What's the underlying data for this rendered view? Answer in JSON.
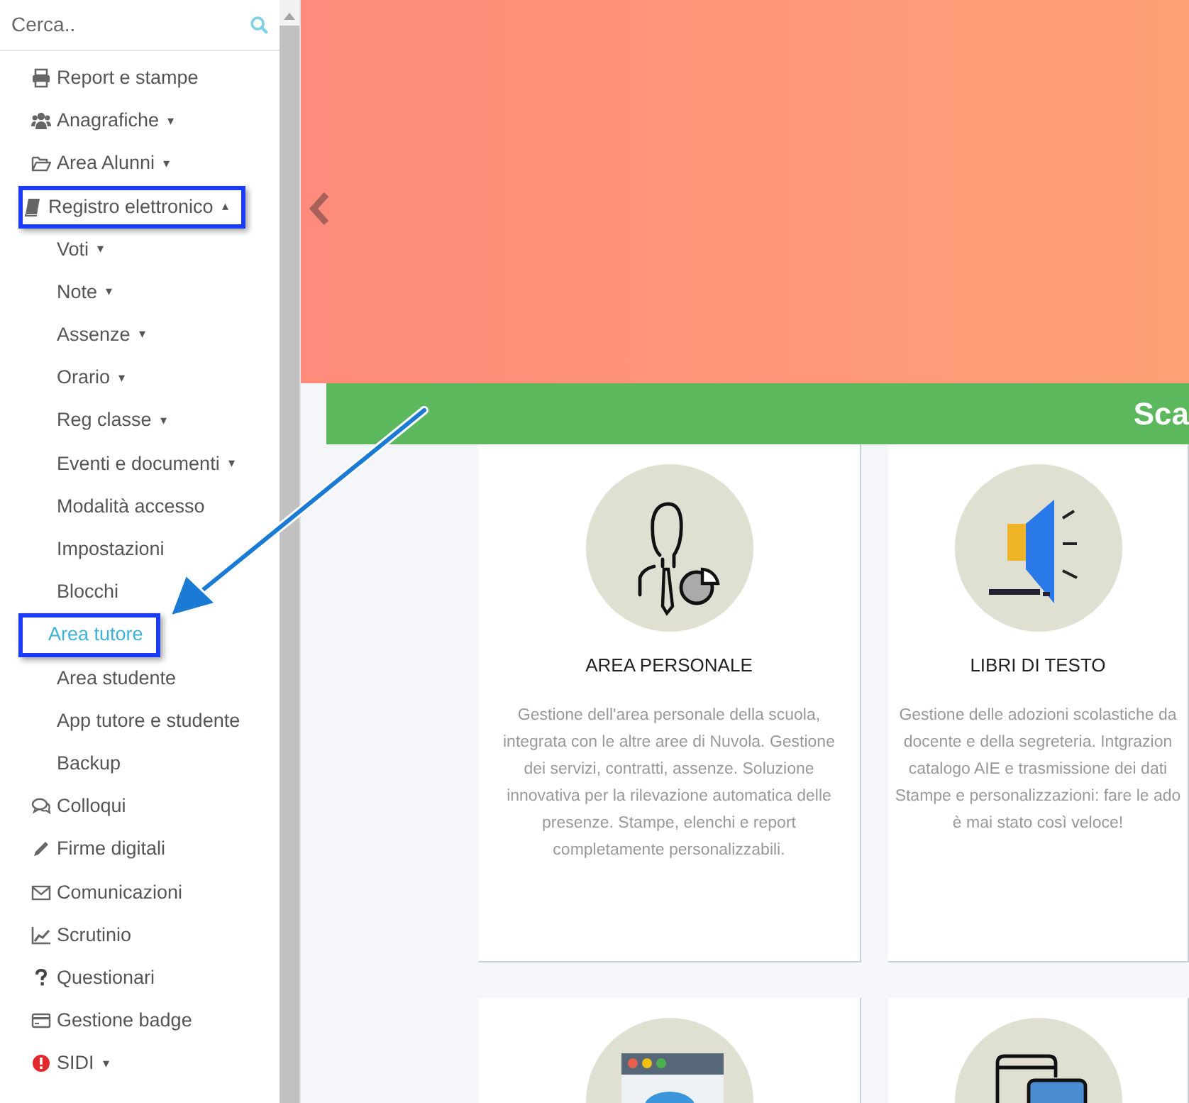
{
  "search": {
    "placeholder": "Cerca.."
  },
  "sidebar": {
    "items": [
      {
        "label": "Report e stampe",
        "selected": false,
        "annotated": false
      },
      {
        "label": "Anagrafiche",
        "caret": "▾",
        "selected": false,
        "annotated": false
      },
      {
        "label": "Area Alunni",
        "caret": "▾",
        "selected": false,
        "annotated": false
      },
      {
        "label": "Registro elettronico",
        "caret": "▴",
        "selected": false,
        "annotated": true,
        "children": [
          {
            "label": "Voti",
            "caret": "▾",
            "selected": false,
            "annotated": false
          },
          {
            "label": "Note",
            "caret": "▾",
            "selected": false,
            "annotated": false
          },
          {
            "label": "Assenze",
            "caret": "▾",
            "selected": false,
            "annotated": false
          },
          {
            "label": "Orario",
            "caret": "▾",
            "selected": false,
            "annotated": false
          },
          {
            "label": "Reg classe",
            "caret": "▾",
            "selected": false,
            "annotated": false
          },
          {
            "label": "Eventi e documenti",
            "caret": "▾",
            "selected": false,
            "annotated": false
          },
          {
            "label": "Modalità accesso",
            "selected": false,
            "annotated": false
          },
          {
            "label": "Impostazioni",
            "selected": false,
            "annotated": false
          },
          {
            "label": "Blocchi",
            "selected": false,
            "annotated": false
          },
          {
            "label": "Area tutore",
            "selected": true,
            "annotated": true
          },
          {
            "label": "Area studente",
            "selected": false,
            "annotated": false
          },
          {
            "label": "App tutore e studente",
            "selected": false,
            "annotated": false
          },
          {
            "label": "Backup",
            "selected": false,
            "annotated": false
          }
        ]
      },
      {
        "label": "Colloqui",
        "selected": false,
        "annotated": false
      },
      {
        "label": "Firme digitali",
        "selected": false,
        "annotated": false
      },
      {
        "label": "Comunicazioni",
        "selected": false,
        "annotated": false
      },
      {
        "label": "Scrutinio",
        "selected": false,
        "annotated": false
      },
      {
        "label": "Questionari",
        "selected": false,
        "annotated": false
      },
      {
        "label": "Gestione badge",
        "selected": false,
        "annotated": false
      },
      {
        "label": "SIDI",
        "caret": "▾",
        "selected": false,
        "annotated": false
      }
    ]
  },
  "section": {
    "title": "Sca"
  },
  "cards": [
    {
      "title": "AREA PERSONALE",
      "lines": [
        "Gestione dell'area personale della scuola,",
        "integrata con le altre aree di Nuvola. Gestione",
        "dei servizi, contratti, assenze. Soluzione",
        "innovativa per la rilevazione automatica delle",
        "presenze. Stampe, elenchi e report",
        "completamente personalizzabili."
      ]
    },
    {
      "title": "LIBRI DI TESTO",
      "lines": [
        "Gestione delle adozioni scolastiche da",
        "docente e della segreteria. Intgrazion",
        "catalogo AIE e trasmissione dei dati",
        "Stampe e personalizzazioni: fare le ado",
        "è mai stato così veloce!"
      ]
    }
  ]
}
